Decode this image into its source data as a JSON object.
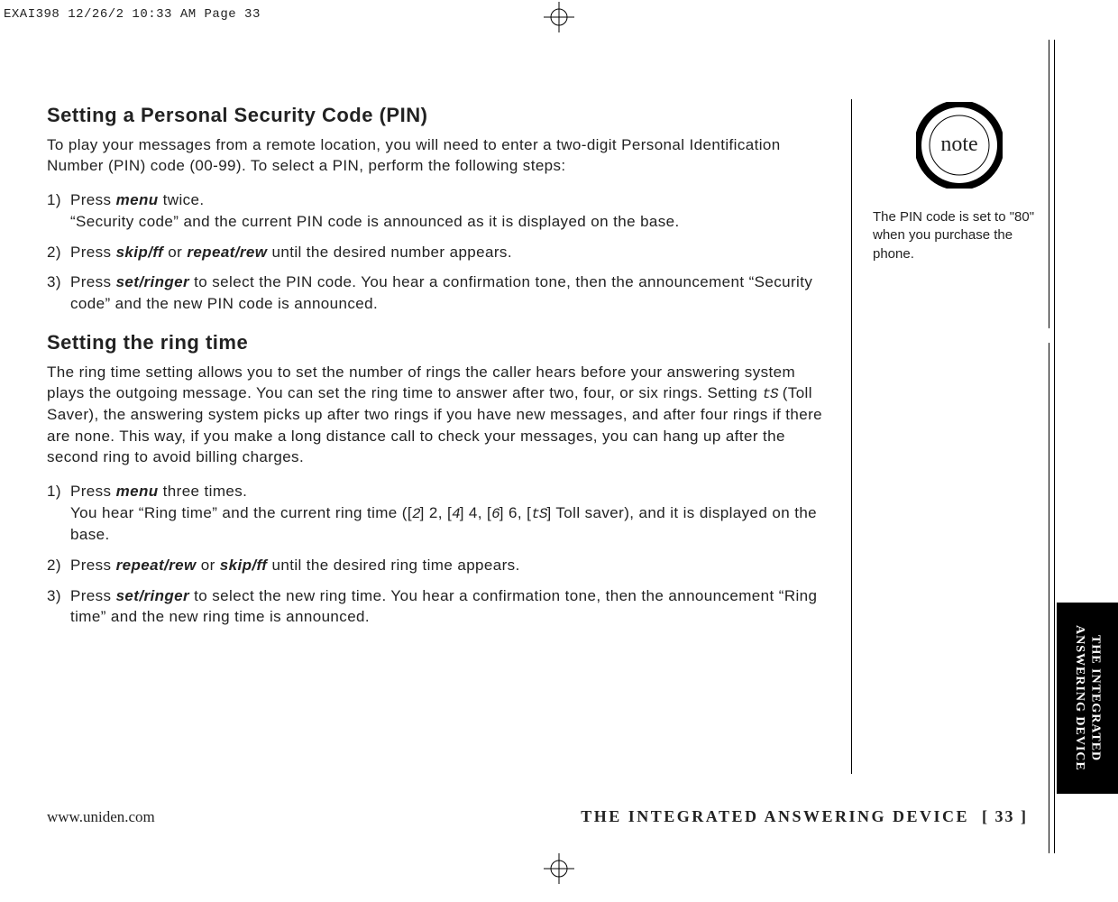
{
  "slug": "EXAI398  12/26/2  10:33 AM  Page 33",
  "section1": {
    "heading": "Setting a Personal Security Code (PIN)",
    "intro": "To play your messages from a remote location, you will need to enter a two-digit Personal Identification Number (PIN) code (00-99). To select a PIN, perform the following steps:",
    "steps": [
      {
        "n": "1)",
        "lead": "Press ",
        "key1": "menu",
        "after1": " twice.",
        "line2": "“Security code” and the current PIN code is announced as it is displayed on the base."
      },
      {
        "n": "2)",
        "lead": "Press ",
        "key1": "skip/ff",
        "mid": " or ",
        "key2": "repeat/rew",
        "after": " until the desired number appears."
      },
      {
        "n": "3)",
        "lead": "Press ",
        "key1": "set/ringer",
        "after": " to select the PIN code. You hear a confirmation tone, then the announcement “Security code” and the new PIN code is announced."
      }
    ]
  },
  "section2": {
    "heading": "Setting the ring time",
    "intro_a": "The ring time setting allows you to set the number of rings the caller hears before your answering system plays the outgoing message. You can set the ring time to answer after two, four, or six rings. Setting ",
    "seg_ts": "tS",
    "intro_b": " (Toll Saver), the answering system picks up after two rings if you have new messages, and after four rings if there are none. This way, if you make a long distance call to check your messages, you can hang up after the second ring to avoid billing charges.",
    "steps": [
      {
        "n": "1)",
        "lead": "Press ",
        "key1": "menu",
        "after1": " three times.",
        "line2a": "You hear “Ring time” and the current ring time ([",
        "seg1": "2",
        "line2b": "] 2, [",
        "seg2": "4",
        "line2c": "] 4, [",
        "seg3": "6",
        "line2d": "] 6, [",
        "seg4": "tS",
        "line2e": "] Toll saver), and it is displayed on the base."
      },
      {
        "n": "2)",
        "lead": "Press ",
        "key1": "repeat/rew",
        "mid": " or ",
        "key2": "skip/ff",
        "after": " until the desired ring time appears."
      },
      {
        "n": "3)",
        "lead": "Press ",
        "key1": "set/ringer",
        "after": " to select the new ring time. You hear a confirmation tone, then the announcement “Ring time” and the new ring time is announced."
      }
    ]
  },
  "sidebar": {
    "icon_label": "note",
    "text": "The PIN code is set to \"80\" when you purchase the phone."
  },
  "tab": "THE INTEGRATED\nANSWERING DEVICE",
  "footer": {
    "url": "www.uniden.com",
    "title": "THE INTEGRATED ANSWERING DEVICE",
    "page": "[ 33 ]"
  }
}
